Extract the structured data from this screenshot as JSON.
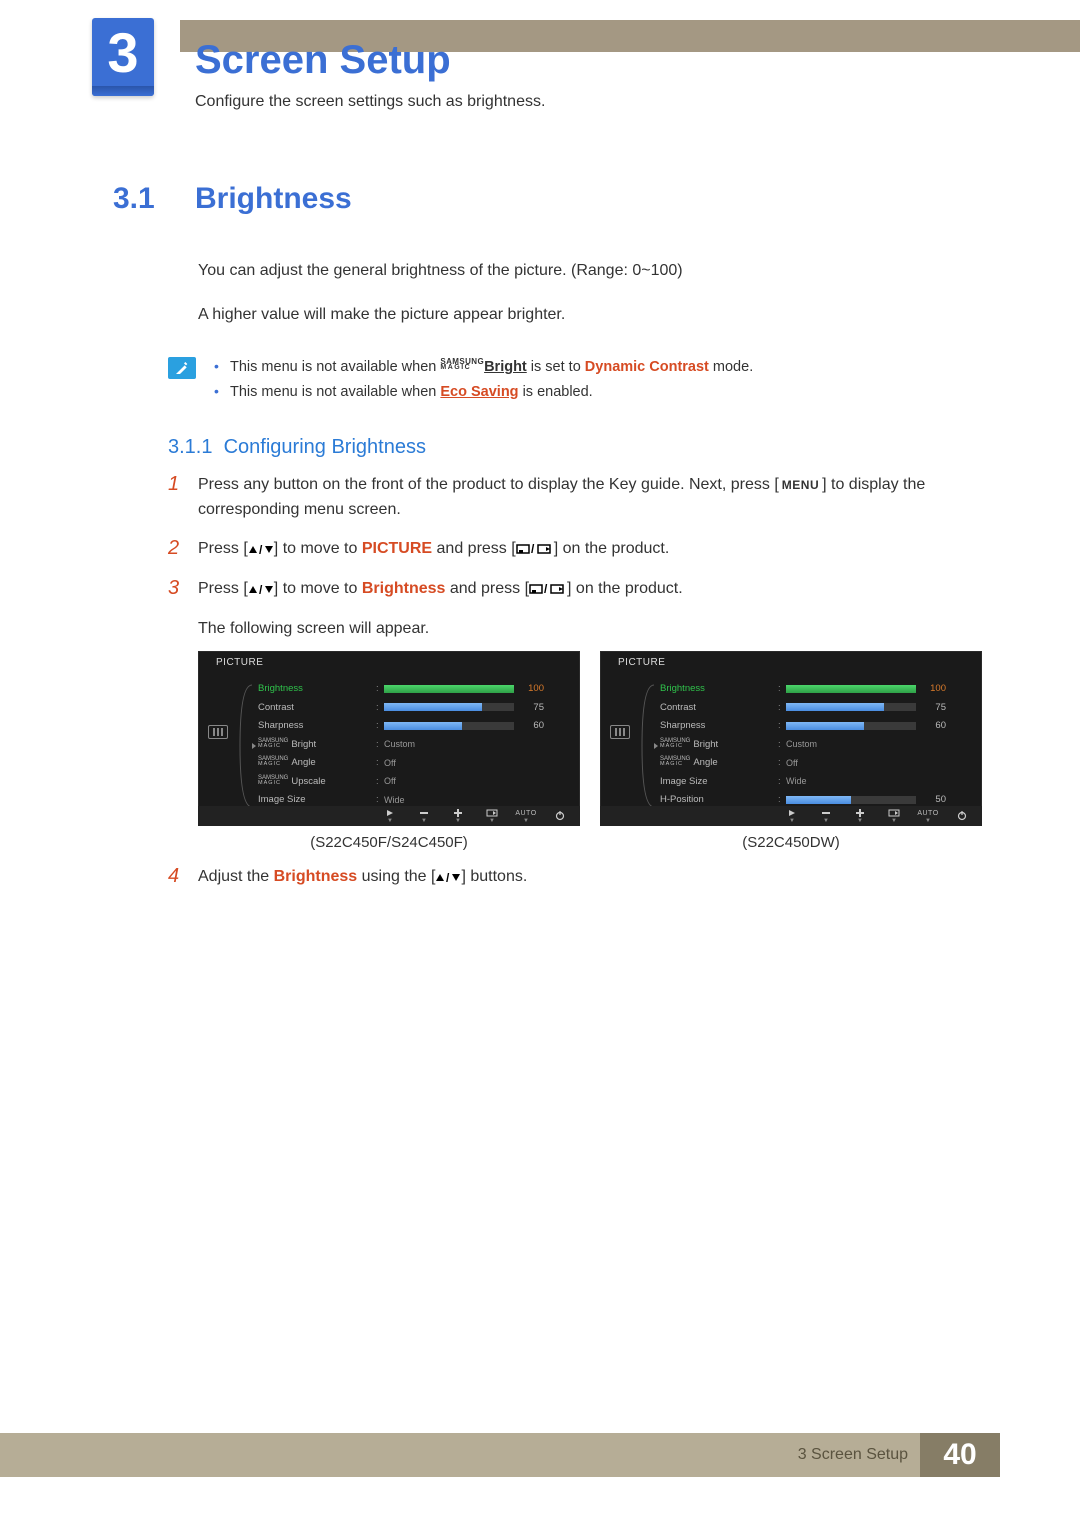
{
  "chapter": {
    "number": "3",
    "title": "Screen Setup",
    "desc": "Configure the screen settings such as brightness."
  },
  "section": {
    "num": "3.1",
    "title": "Brightness",
    "p1": "You can adjust the general brightness of the picture. (Range: 0~100)",
    "p2": "A higher value will make the picture appear brighter."
  },
  "notes": {
    "n1_pre": "This menu is not available when ",
    "n1_magic": "Bright",
    "n1_mid": " is set to ",
    "n1_mode": "Dynamic Contrast",
    "n1_post": " mode.",
    "n2_pre": "This menu is not available when ",
    "n2_link": "Eco Saving",
    "n2_post": " is enabled."
  },
  "subsection": {
    "num": "3.1.1",
    "title": "Configuring Brightness"
  },
  "steps": {
    "s1a": "Press any button on the front of the product to display the Key guide. Next, press [",
    "s1_menu": "MENU",
    "s1b": "] to display the corresponding menu screen.",
    "s2a": "Press [",
    "s2b": "] to move to ",
    "s2_pic": "PICTURE",
    "s2c": " and press [",
    "s2d": "] on the product.",
    "s3a": "Press [",
    "s3b": "] to move to ",
    "s3_bri": "Brightness",
    "s3c": " and press [",
    "s3d": "] on the product.",
    "s3_follow": "The following screen will appear.",
    "s4a": "Adjust the ",
    "s4_bri": "Brightness",
    "s4b": " using the [",
    "s4c": "] buttons."
  },
  "osd": {
    "title": "PICTURE",
    "caption_left": "(S22C450F/S24C450F)",
    "caption_right": "(S22C450DW)",
    "left_items": [
      {
        "label": "Brightness",
        "type": "bar",
        "value": "100",
        "fill": 100,
        "hl": true
      },
      {
        "label": "Contrast",
        "type": "bar",
        "value": "75",
        "fill": 75
      },
      {
        "label": "Sharpness",
        "type": "bar",
        "value": "60",
        "fill": 60
      },
      {
        "label": "MAGIC",
        "sub": "Bright",
        "type": "text",
        "value": "Custom"
      },
      {
        "label": "MAGIC",
        "sub": "Angle",
        "type": "text",
        "value": "Off"
      },
      {
        "label": "MAGIC",
        "sub": "Upscale",
        "type": "text",
        "value": "Off"
      },
      {
        "label": "Image Size",
        "type": "text",
        "value": "Wide"
      }
    ],
    "right_items": [
      {
        "label": "Brightness",
        "type": "bar",
        "value": "100",
        "fill": 100,
        "hl": true
      },
      {
        "label": "Contrast",
        "type": "bar",
        "value": "75",
        "fill": 75
      },
      {
        "label": "Sharpness",
        "type": "bar",
        "value": "60",
        "fill": 60
      },
      {
        "label": "MAGIC",
        "sub": "Bright",
        "type": "text",
        "value": "Custom"
      },
      {
        "label": "MAGIC",
        "sub": "Angle",
        "type": "text",
        "value": "Off"
      },
      {
        "label": "Image Size",
        "type": "text",
        "value": "Wide"
      },
      {
        "label": "H-Position",
        "type": "bar",
        "value": "50",
        "fill": 50
      }
    ],
    "footer_auto": "AUTO"
  },
  "footer": {
    "text": "3 Screen Setup",
    "page": "40"
  }
}
